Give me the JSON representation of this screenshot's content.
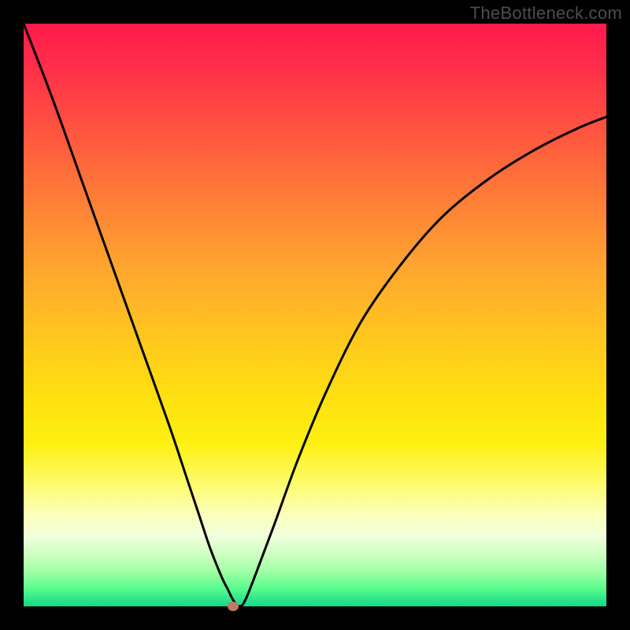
{
  "watermark": "TheBottleneck.com",
  "chart_data": {
    "type": "line",
    "title": "",
    "xlabel": "",
    "ylabel": "",
    "xlim": [
      0,
      100
    ],
    "ylim": [
      0,
      100
    ],
    "grid": false,
    "series": [
      {
        "name": "bottleneck-curve",
        "x": [
          0,
          5,
          10,
          15,
          20,
          25,
          28,
          30,
          32,
          34,
          35,
          36,
          37,
          38,
          40,
          43,
          47,
          52,
          58,
          65,
          72,
          80,
          88,
          95,
          100
        ],
        "values": [
          100,
          87,
          73,
          59,
          45,
          31,
          22,
          16,
          10,
          5,
          3,
          1,
          0,
          1,
          6,
          14,
          25,
          37,
          49,
          59,
          67,
          73.5,
          78.5,
          82,
          84
        ]
      }
    ],
    "marker": {
      "x": 36,
      "y": 0
    },
    "gradient_stops": [
      {
        "pos": 0,
        "color": "#ff1a4c"
      },
      {
        "pos": 8,
        "color": "#ff3049"
      },
      {
        "pos": 20,
        "color": "#ff5a3e"
      },
      {
        "pos": 30,
        "color": "#ff7d37"
      },
      {
        "pos": 42,
        "color": "#ffa62f"
      },
      {
        "pos": 54,
        "color": "#ffc71e"
      },
      {
        "pos": 64,
        "color": "#ffe010"
      },
      {
        "pos": 72,
        "color": "#fdf010"
      },
      {
        "pos": 79,
        "color": "#fdfb6d"
      },
      {
        "pos": 84,
        "color": "#fcffb7"
      },
      {
        "pos": 88,
        "color": "#f1ffdd"
      },
      {
        "pos": 91,
        "color": "#cfffc3"
      },
      {
        "pos": 94,
        "color": "#a0ffa6"
      },
      {
        "pos": 97,
        "color": "#58fb8e"
      },
      {
        "pos": 99,
        "color": "#28e389"
      },
      {
        "pos": 100,
        "color": "#17d886"
      }
    ]
  }
}
